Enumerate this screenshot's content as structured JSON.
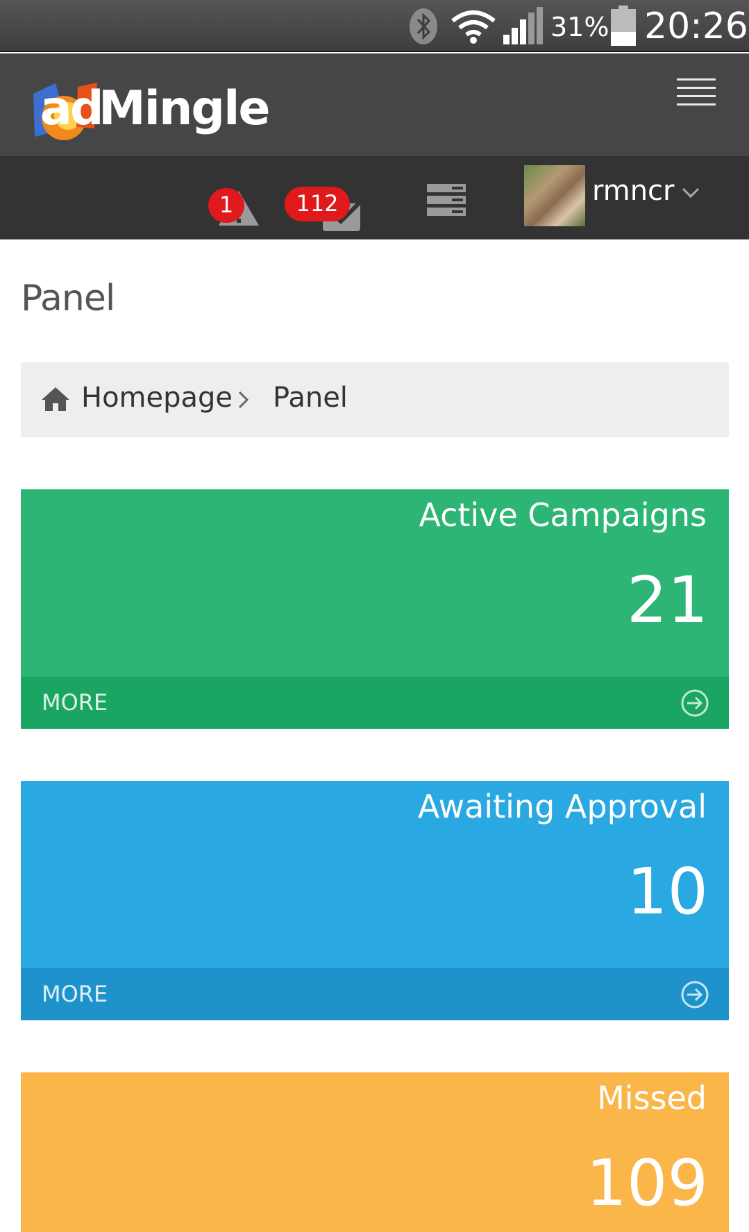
{
  "status_bar": {
    "battery_percent": "31%",
    "time": "20:26",
    "icons": [
      "bluetooth-icon",
      "wifi-icon",
      "signal-icon",
      "battery-icon"
    ]
  },
  "header": {
    "logo_ad": "ad",
    "logo_mingle": "Mingle",
    "menu_icon": "hamburger-icon"
  },
  "toolbar": {
    "alerts_count": "1",
    "messages_count": "112",
    "username": "rmncr"
  },
  "page": {
    "title": "Panel"
  },
  "breadcrumb": {
    "home": "Homepage",
    "current": "Panel"
  },
  "tiles": [
    {
      "title": "Active Campaigns",
      "value": "21",
      "more": "MORE",
      "color": "#2cb574"
    },
    {
      "title": "Awaiting Approval",
      "value": "10",
      "more": "MORE",
      "color": "#29a8e2"
    },
    {
      "title": "Missed",
      "value": "109",
      "color": "#fbb64a"
    }
  ]
}
